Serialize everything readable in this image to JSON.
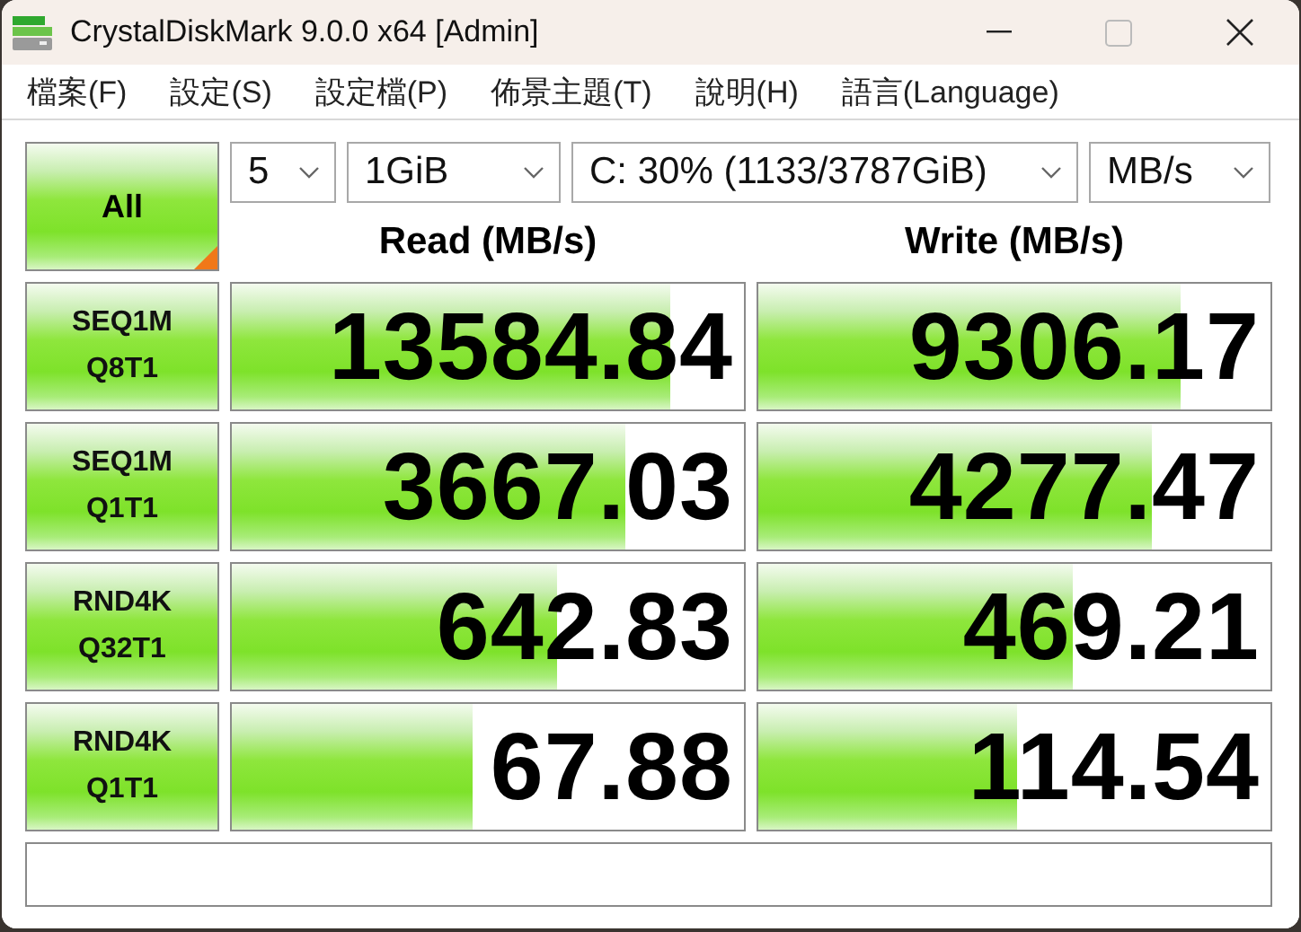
{
  "window": {
    "title": "CrystalDiskMark 9.0.0 x64 [Admin]"
  },
  "menu": [
    "檔案(F)",
    "設定(S)",
    "設定檔(P)",
    "佈景主題(T)",
    "說明(H)",
    "語言(Language)"
  ],
  "all_button": {
    "label": "All"
  },
  "dropdowns": [
    {
      "value": "5"
    },
    {
      "value": "1GiB"
    },
    {
      "value": "C: 30% (1133/3787GiB)"
    },
    {
      "value": "MB/s"
    }
  ],
  "headers": {
    "read": "Read (MB/s)",
    "write": "Write (MB/s)"
  },
  "tests": [
    {
      "name": "SEQ1M",
      "params": "Q8T1",
      "read": {
        "value": "13584.84",
        "level": 0.857
      },
      "write": {
        "value": "9306.17",
        "level": 0.826
      }
    },
    {
      "name": "SEQ1M",
      "params": "Q1T1",
      "read": {
        "value": "3667.03",
        "level": 0.767
      },
      "write": {
        "value": "4277.47",
        "level": 0.767
      }
    },
    {
      "name": "RND4K",
      "params": "Q32T1",
      "read": {
        "value": "642.83",
        "level": 0.634
      },
      "write": {
        "value": "469.21",
        "level": 0.613
      }
    },
    {
      "name": "RND4K",
      "params": "Q1T1",
      "read": {
        "value": "67.88",
        "level": 0.47
      },
      "write": {
        "value": "114.54",
        "level": 0.505
      }
    }
  ]
}
